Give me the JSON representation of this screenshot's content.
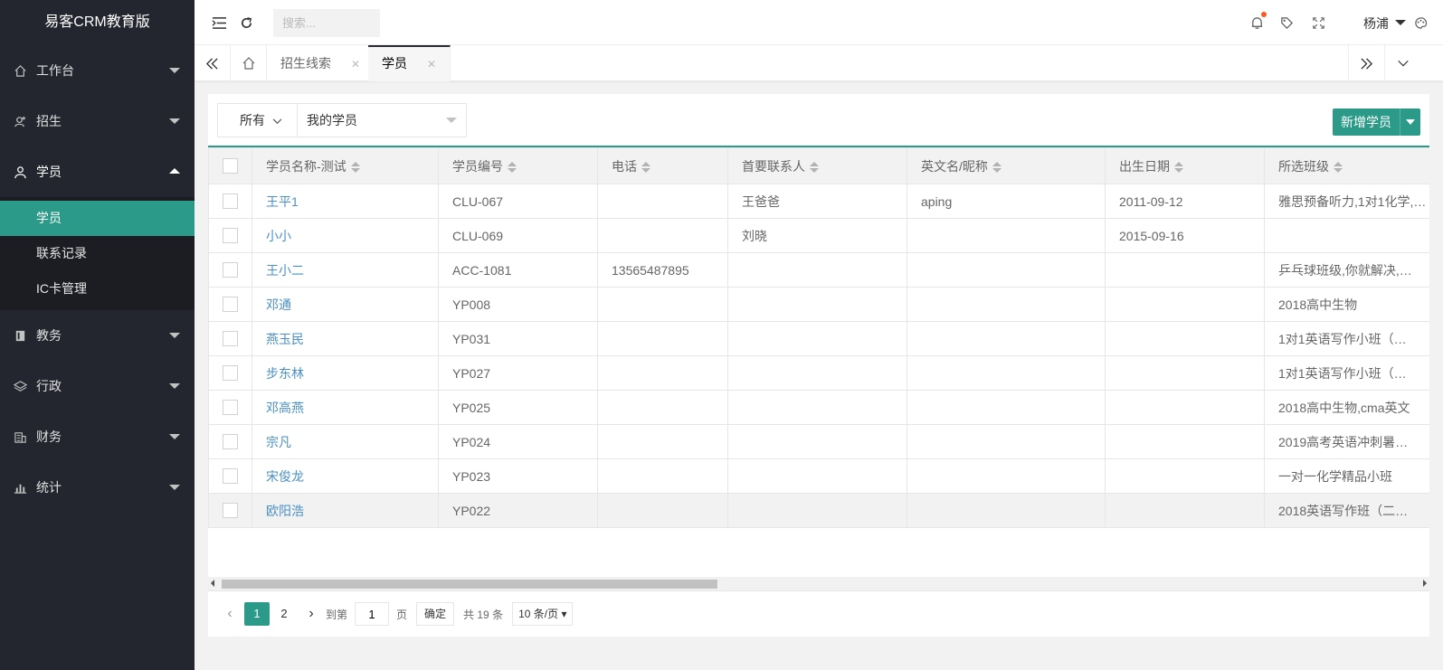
{
  "app": {
    "title": "易客CRM教育版"
  },
  "sidebar": {
    "items": [
      {
        "label": "工作台",
        "icon": "home-icon"
      },
      {
        "label": "招生",
        "icon": "user-add-icon"
      },
      {
        "label": "学员",
        "icon": "user-icon",
        "open": true
      },
      {
        "label": "教务",
        "icon": "book-icon"
      },
      {
        "label": "行政",
        "icon": "layers-icon"
      },
      {
        "label": "财务",
        "icon": "finance-icon"
      },
      {
        "label": "统计",
        "icon": "chart-icon"
      }
    ],
    "subitems": [
      {
        "label": "学员",
        "active": true
      },
      {
        "label": "联系记录"
      },
      {
        "label": "IC卡管理"
      }
    ]
  },
  "header": {
    "search_placeholder": "搜索...",
    "user_name": "杨浦"
  },
  "tabs": [
    {
      "label": "招生线索"
    },
    {
      "label": "学员",
      "active": true
    }
  ],
  "toolbar": {
    "filter_all": "所有",
    "filter_select": "我的学员",
    "add_button": "新增学员"
  },
  "table": {
    "columns": [
      "学员名称-测试",
      "学员编号",
      "电话",
      "首要联系人",
      "英文名/昵称",
      "出生日期",
      "所选班级"
    ],
    "rows": [
      [
        "王平1",
        "CLU-067",
        "",
        "王爸爸",
        "aping",
        "2011-09-12",
        "雅思预备听力,1对1化学,…"
      ],
      [
        "小小",
        "CLU-069",
        "",
        "刘晓",
        "",
        "2015-09-16",
        ""
      ],
      [
        "王小二",
        "ACC-1081",
        "13565487895",
        "",
        "",
        "",
        "乒乓球班级,你就解决,…"
      ],
      [
        "邓通",
        "YP008",
        "",
        "",
        "",
        "",
        "2018高中生物"
      ],
      [
        "燕玉民",
        "YP031",
        "",
        "",
        "",
        "",
        "1对1英语写作小班（…"
      ],
      [
        "步东林",
        "YP027",
        "",
        "",
        "",
        "",
        "1对1英语写作小班（…"
      ],
      [
        "邓高燕",
        "YP025",
        "",
        "",
        "",
        "",
        "2018高中生物,cma英文"
      ],
      [
        "宗凡",
        "YP024",
        "",
        "",
        "",
        "",
        "2019高考英语冲刺暑…"
      ],
      [
        "宋俊龙",
        "YP023",
        "",
        "",
        "",
        "",
        "一对一化学精品小班"
      ],
      [
        "欧阳浩",
        "YP022",
        "",
        "",
        "",
        "",
        "2018英语写作班（二…"
      ]
    ]
  },
  "pager": {
    "pages": [
      "1",
      "2"
    ],
    "current": "1",
    "goto_label": "到第",
    "goto_value": "1",
    "page_unit": "页",
    "ok": "确定",
    "total": "共 19 条",
    "size": "10 条/页"
  },
  "colors": {
    "accent": "#2c9a88",
    "sidebar": "#23262e",
    "link": "#4a90c4"
  }
}
